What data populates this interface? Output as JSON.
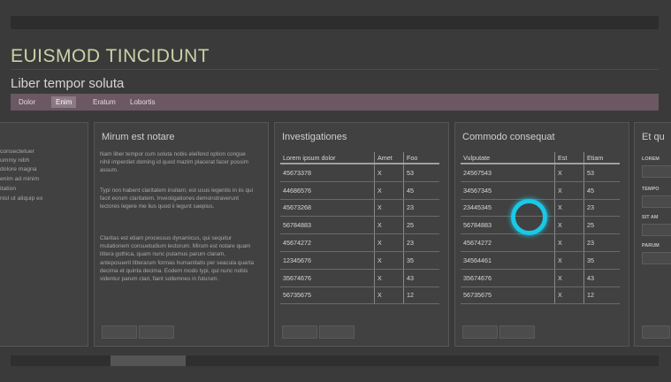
{
  "app": {
    "title": "EUISMOD TINCIDUNT"
  },
  "page": {
    "subtitle": "Liber tempor soluta"
  },
  "tabs": [
    {
      "label": "Dolor"
    },
    {
      "label": "Enim",
      "active": true
    },
    {
      "label": "Eratum"
    },
    {
      "label": "Lobortis"
    }
  ],
  "left_fragment": {
    "lines": [
      "consectetuer",
      "ummy nibh",
      "dolore magna",
      "enim ad minim",
      "itation",
      "nisl ut aliquip ex"
    ]
  },
  "panel_mirum": {
    "title": "Mirum est notare",
    "paragraphs": [
      "Nam liber tempor cum soluta nobis eleifend option congue nihil imperdiet doming id quod mazim placerat facer possim assum.",
      "Typi non habent claritatem insitam; est usus legentis in iis qui facit eorum claritatem. Investigationes demonstraverunt lectores legere me lius quod ii legunt saepius.",
      "Claritas est etiam processus dynamicus, qui sequitur mutationem consuetudium lectorum. Mirum est notare quam littera gothica, quam nunc putamus parum claram, anteposuerit litterarum formas humanitatis per seacula quarta decima et quinta decima. Eodem modo typi, qui nunc nobis videntur parum clari, fiant sollemnes in futurum."
    ]
  },
  "panel_investigationes": {
    "title": "Investigationes",
    "columns": [
      "Lorem ipsum dolor",
      "Amet",
      "Foo"
    ],
    "rows": [
      [
        "45673378",
        "X",
        "53"
      ],
      [
        "44686576",
        "X",
        "45"
      ],
      [
        "45673268",
        "X",
        "23"
      ],
      [
        "56784883",
        "X",
        "25"
      ],
      [
        "45674272",
        "X",
        "23"
      ],
      [
        "12345676",
        "X",
        "35"
      ],
      [
        "35674676",
        "X",
        "43"
      ],
      [
        "56735675",
        "X",
        "12"
      ]
    ]
  },
  "panel_commodo": {
    "title": "Commodo consequat",
    "columns": [
      "Vulputate",
      "Est",
      "Etiam"
    ],
    "rows": [
      [
        "24567543",
        "X",
        "53"
      ],
      [
        "34567345",
        "X",
        "45"
      ],
      [
        "23445345",
        "X",
        "23"
      ],
      [
        "56784883",
        "X",
        "25"
      ],
      [
        "45674272",
        "X",
        "23"
      ],
      [
        "34564461",
        "X",
        "35"
      ],
      [
        "35674676",
        "X",
        "43"
      ],
      [
        "56735675",
        "X",
        "12"
      ]
    ]
  },
  "panel_right": {
    "title": "Et qu",
    "labels": [
      "LOREM",
      "TEMPO",
      "SIT AM",
      "PARUM"
    ]
  },
  "colors": {
    "tabbar": "#6b5862",
    "title": "#c9d3a6",
    "cursor": "#19c9e6"
  }
}
